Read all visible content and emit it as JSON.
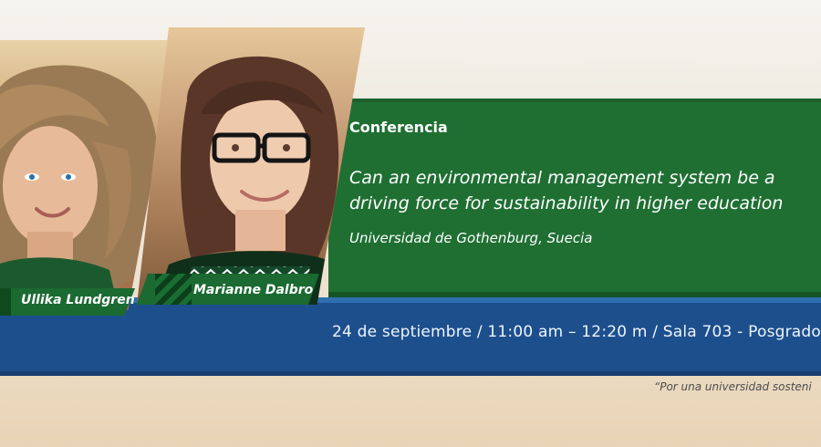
{
  "event": {
    "label": "Conferencia",
    "title_line_1": "Can an environmental management system be a",
    "title_line_2": "driving force for sustainability in higher education",
    "institution": "Universidad de Gothenburg, Suecia",
    "details": "24 de septiembre / 11:00 am – 12:20 m / Sala 703 -  Posgrados",
    "tagline": "“Por una universidad sosteni"
  },
  "speakers": [
    {
      "name": "Ullika Lundgren"
    },
    {
      "name": "Marianne Dalbro"
    }
  ],
  "colors": {
    "green": "#1f6f33",
    "blue": "#1d4f8d",
    "background": "#efe9dd"
  }
}
